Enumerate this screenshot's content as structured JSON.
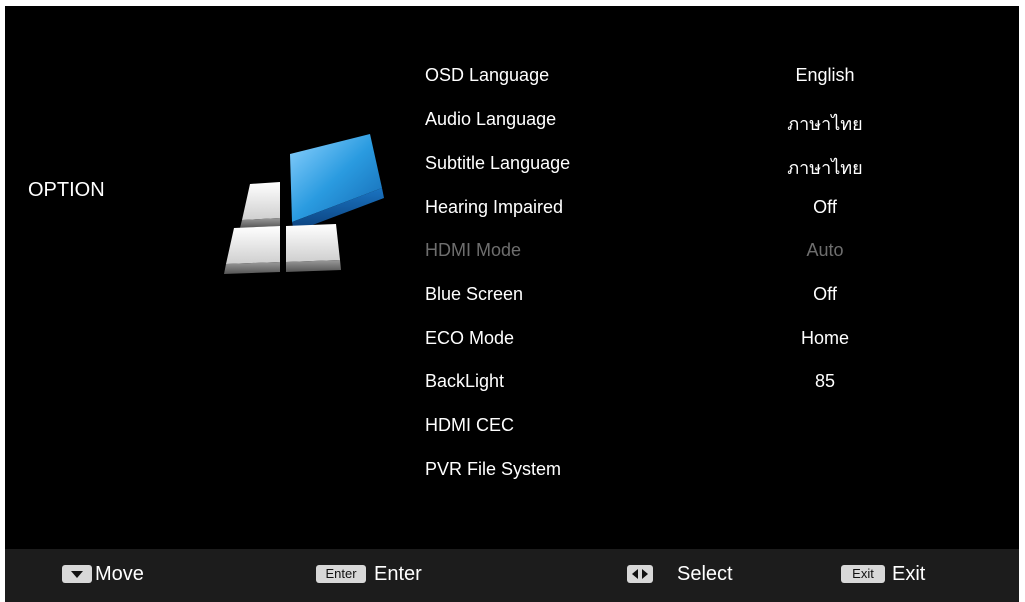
{
  "section": {
    "title": "OPTION"
  },
  "menu": [
    {
      "label": "OSD Language",
      "value": "English",
      "enabled": true
    },
    {
      "label": "Audio Language",
      "value": "ภาษาไทย",
      "enabled": true
    },
    {
      "label": "Subtitle Language",
      "value": "ภาษาไทย",
      "enabled": true
    },
    {
      "label": "Hearing Impaired",
      "value": "Off",
      "enabled": true
    },
    {
      "label": "HDMI Mode",
      "value": "Auto",
      "enabled": false
    },
    {
      "label": "Blue Screen",
      "value": "Off",
      "enabled": true
    },
    {
      "label": "ECO Mode",
      "value": "Home",
      "enabled": true
    },
    {
      "label": "BackLight",
      "value": "85",
      "enabled": true
    },
    {
      "label": "HDMI CEC",
      "value": "",
      "enabled": true
    },
    {
      "label": "PVR File System",
      "value": "",
      "enabled": true
    }
  ],
  "footer": {
    "move": {
      "icon": "down-arrow-icon",
      "label": "Move"
    },
    "enter": {
      "key": "Enter",
      "label": "Enter"
    },
    "select": {
      "icon": "left-right-arrows-icon",
      "label": "Select"
    },
    "exit": {
      "key": "Exit",
      "label": "Exit"
    }
  },
  "colors": {
    "background": "#000000",
    "text": "#ffffff",
    "disabled_text": "#6e6e6e",
    "footer_bg": "#1c1c1c",
    "accent_blue": "#2a9be0"
  }
}
